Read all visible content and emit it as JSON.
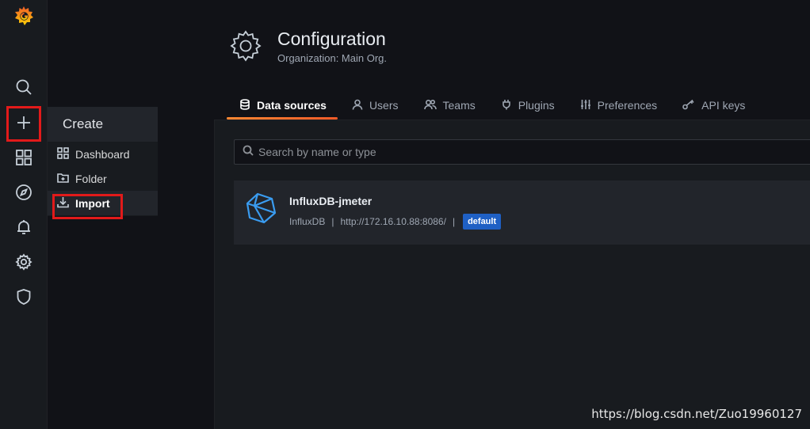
{
  "sidebar": {
    "items": [
      "grafana-logo",
      "search-icon",
      "plus-icon",
      "dashboards-icon",
      "explore-icon",
      "alerting-icon",
      "configuration-icon",
      "server-admin-icon"
    ]
  },
  "create_menu": {
    "title": "Create",
    "items": [
      {
        "label": "Dashboard",
        "icon": "apps-icon"
      },
      {
        "label": "Folder",
        "icon": "folder-plus-icon"
      },
      {
        "label": "Import",
        "icon": "import-icon"
      }
    ]
  },
  "header": {
    "title": "Configuration",
    "subtitle": "Organization: Main Org."
  },
  "tabs": [
    {
      "label": "Data sources",
      "icon": "database-icon",
      "active": true
    },
    {
      "label": "Users",
      "icon": "user-icon"
    },
    {
      "label": "Teams",
      "icon": "users-alt-icon"
    },
    {
      "label": "Plugins",
      "icon": "plug-icon"
    },
    {
      "label": "Preferences",
      "icon": "sliders-icon"
    },
    {
      "label": "API keys",
      "icon": "key-icon"
    }
  ],
  "search": {
    "placeholder": "Search by name or type"
  },
  "datasources": [
    {
      "name": "InfluxDB-jmeter",
      "type": "InfluxDB",
      "url": "http://172.16.10.88:8086/",
      "separator": "|",
      "badge": "default"
    }
  ],
  "watermark": "https://blog.csdn.net/Zuo19960127",
  "colors": {
    "background": "#111217",
    "panel": "#181b1f",
    "accent": "#f05a28",
    "badge": "#1f60c4",
    "highlight": "#e21a1a"
  }
}
